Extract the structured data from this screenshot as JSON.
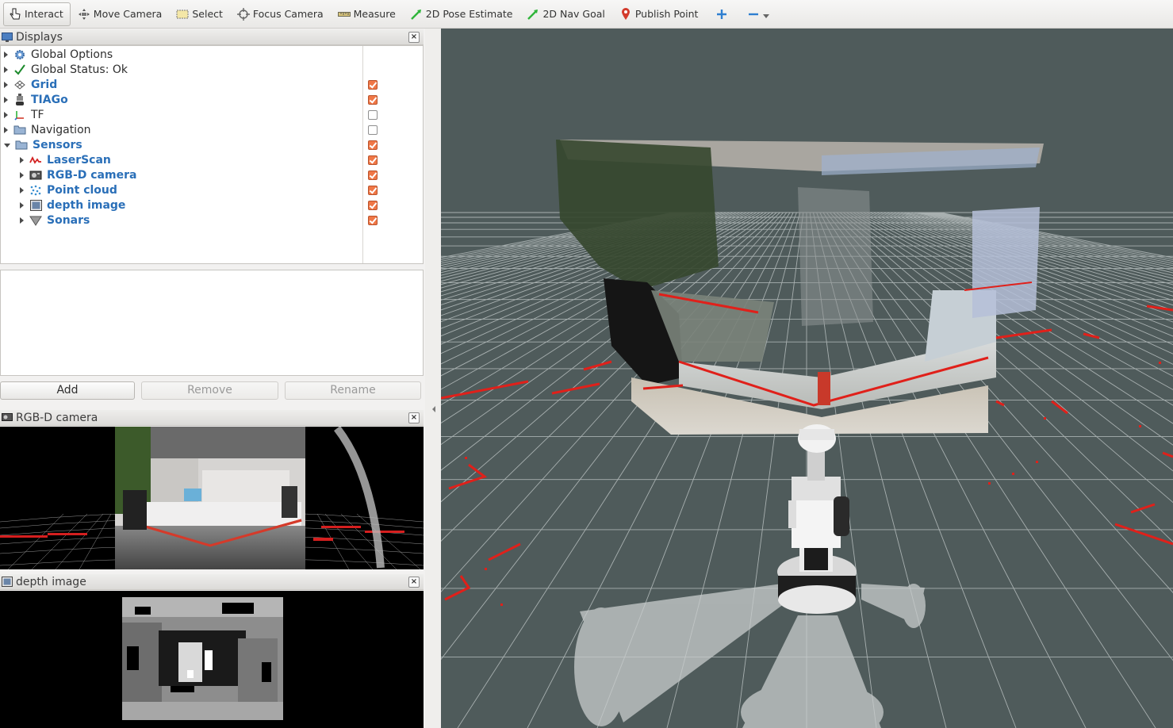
{
  "toolbar": {
    "tools": [
      {
        "label": "Interact",
        "icon": "hand-pointer-icon"
      },
      {
        "label": "Move Camera",
        "icon": "move-camera-icon"
      },
      {
        "label": "Select",
        "icon": "select-box-icon"
      },
      {
        "label": "Focus Camera",
        "icon": "focus-camera-icon"
      },
      {
        "label": "Measure",
        "icon": "ruler-icon"
      },
      {
        "label": "2D Pose Estimate",
        "icon": "green-arrow-icon"
      },
      {
        "label": "2D Nav Goal",
        "icon": "green-arrow-icon"
      },
      {
        "label": "Publish Point",
        "icon": "map-pin-icon"
      }
    ],
    "active": "Interact"
  },
  "displays": {
    "title": "Displays",
    "items": [
      {
        "label": "Global Options",
        "icon": "gear-icon",
        "checked": null,
        "highlight": false
      },
      {
        "label": "Global Status: Ok",
        "icon": "check-icon",
        "checked": null,
        "highlight": false
      },
      {
        "label": "Grid",
        "icon": "grid-icon",
        "checked": true,
        "highlight": true
      },
      {
        "label": "TIAGo",
        "icon": "robot-icon",
        "checked": true,
        "highlight": true
      },
      {
        "label": "TF",
        "icon": "axes-icon",
        "checked": false,
        "highlight": false
      },
      {
        "label": "Navigation",
        "icon": "folder-icon",
        "checked": false,
        "highlight": false
      },
      {
        "label": "Sensors",
        "icon": "folder-icon",
        "checked": true,
        "highlight": true
      },
      {
        "label": "LaserScan",
        "icon": "laser-scan-icon",
        "checked": true,
        "highlight": true
      },
      {
        "label": "RGB-D camera",
        "icon": "camera-icon",
        "checked": true,
        "highlight": true
      },
      {
        "label": "Point cloud",
        "icon": "point-cloud-icon",
        "checked": true,
        "highlight": true
      },
      {
        "label": "depth image",
        "icon": "image-icon",
        "checked": true,
        "highlight": true
      },
      {
        "label": "Sonars",
        "icon": "sonar-icon",
        "checked": true,
        "highlight": true
      }
    ],
    "buttons": {
      "add": "Add",
      "remove": "Remove",
      "rename": "Rename"
    }
  },
  "panels": {
    "rgbd": "RGB-D camera",
    "depth": "depth image"
  },
  "colors": {
    "accent": "#2a6fb8",
    "checkbox": "#f07746",
    "viewport_bg": "#4f5b5b",
    "laser": "#e0201a"
  }
}
